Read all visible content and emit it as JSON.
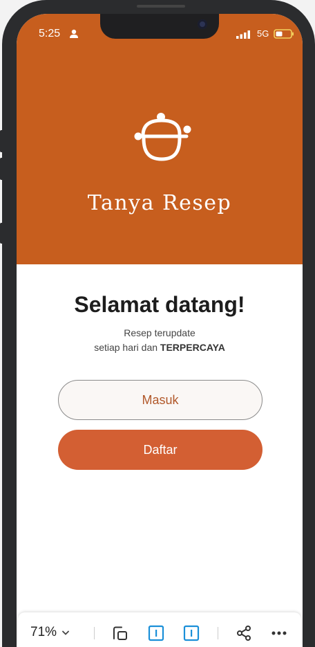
{
  "status_bar": {
    "time": "5:25",
    "network": "5G"
  },
  "app": {
    "title": "Tanya Resep"
  },
  "welcome": {
    "heading": "Selamat datang!",
    "subtitle_line1": "Resep terupdate",
    "subtitle_line2_prefix": "setiap hari dan ",
    "subtitle_line2_bold": "TERPERCAYA"
  },
  "buttons": {
    "login_label": "Masuk",
    "register_label": "Daftar"
  },
  "toolbar": {
    "zoom_label": "71%",
    "icons": [
      "rotate-device-icon",
      "portrait-icon",
      "portrait-icon-alt",
      "share-icon",
      "more-icon"
    ]
  },
  "colors": {
    "brand": "#c75e1e",
    "register_button": "#d35f33",
    "login_text": "#b1582a",
    "frame": "#2b2c2e",
    "toolbar_accent": "#1a8fd8"
  }
}
